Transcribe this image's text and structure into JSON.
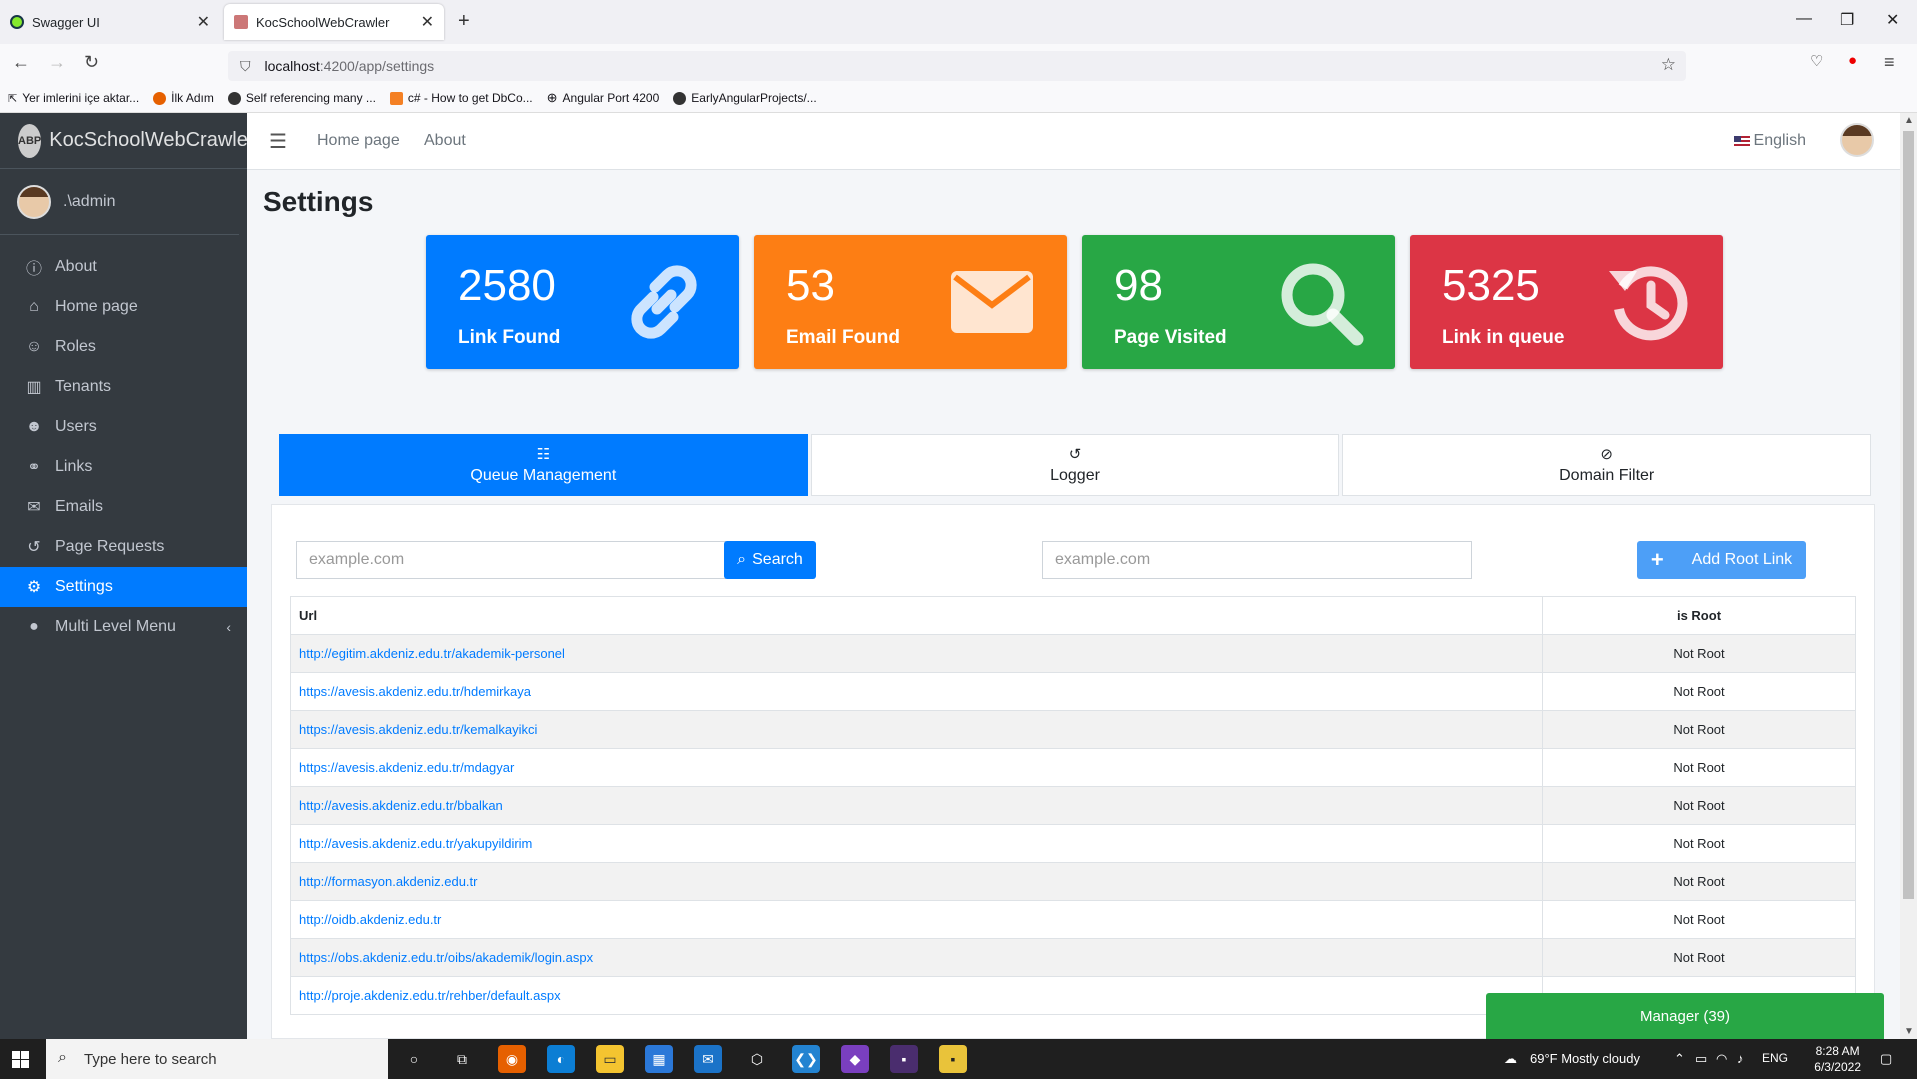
{
  "browser": {
    "tabs": [
      {
        "title": "Swagger UI",
        "active": false
      },
      {
        "title": "KocSchoolWebCrawler",
        "active": true
      }
    ],
    "url_host": "localhost",
    "url_path": ":4200/app/settings",
    "bookmarks": [
      "Yer imlerini içe aktar...",
      "İlk Adım",
      "Self referencing many ...",
      "c# - How to get DbCo...",
      "Angular Port 4200",
      "EarlyAngularProjects/..."
    ]
  },
  "sidebar": {
    "brand": "KocSchoolWebCrawler",
    "logo_text": "ABP",
    "user": ".\\admin",
    "items": [
      {
        "label": "About",
        "icon": "info-icon"
      },
      {
        "label": "Home page",
        "icon": "home-icon"
      },
      {
        "label": "Roles",
        "icon": "theater-masks-icon"
      },
      {
        "label": "Tenants",
        "icon": "building-icon"
      },
      {
        "label": "Users",
        "icon": "users-icon"
      },
      {
        "label": "Links",
        "icon": "link-icon"
      },
      {
        "label": "Emails",
        "icon": "envelope-icon"
      },
      {
        "label": "Page Requests",
        "icon": "history-icon"
      },
      {
        "label": "Settings",
        "icon": "gear-icon",
        "active": true
      },
      {
        "label": "Multi Level Menu",
        "icon": "circle-icon"
      }
    ]
  },
  "topnav": {
    "links": [
      "Home page",
      "About"
    ],
    "language": "English"
  },
  "page": {
    "title": "Settings",
    "stats": [
      {
        "value": "2580",
        "label": "Link Found",
        "color": "#007bff",
        "icon": "link-icon"
      },
      {
        "value": "53",
        "label": "Email Found",
        "color": "#fd7e14",
        "icon": "envelope-icon"
      },
      {
        "value": "98",
        "label": "Page Visited",
        "color": "#28a745",
        "icon": "search-icon"
      },
      {
        "value": "5325",
        "label": "Link in queue",
        "color": "#dc3545",
        "icon": "history-icon"
      }
    ],
    "tabs": [
      {
        "label": "Queue Management",
        "icon": "list-icon",
        "active": true
      },
      {
        "label": "Logger",
        "icon": "history-icon"
      },
      {
        "label": "Domain Filter",
        "icon": "ban-icon"
      }
    ],
    "search": {
      "placeholder": "example.com",
      "button": "Search"
    },
    "add_root": {
      "placeholder": "example.com",
      "button": "Add Root Link"
    },
    "table": {
      "headers": [
        "Url",
        "is Root"
      ],
      "rows": [
        [
          "http://egitim.akdeniz.edu.tr/akademik-personel",
          "Not Root"
        ],
        [
          "https://avesis.akdeniz.edu.tr/hdemirkaya",
          "Not Root"
        ],
        [
          "https://avesis.akdeniz.edu.tr/kemalkayikci",
          "Not Root"
        ],
        [
          "https://avesis.akdeniz.edu.tr/mdagyar",
          "Not Root"
        ],
        [
          "http://avesis.akdeniz.edu.tr/bbalkan",
          "Not Root"
        ],
        [
          "http://avesis.akdeniz.edu.tr/yakupyildirim",
          "Not Root"
        ],
        [
          "http://formasyon.akdeniz.edu.tr",
          "Not Root"
        ],
        [
          "http://oidb.akdeniz.edu.tr",
          "Not Root"
        ],
        [
          "https://obs.akdeniz.edu.tr/oibs/akademik/login.aspx",
          "Not Root"
        ],
        [
          "http://proje.akdeniz.edu.tr/rehber/default.aspx",
          ""
        ]
      ]
    },
    "manager_button": "Manager (39)"
  },
  "taskbar": {
    "search_placeholder": "Type here to search",
    "weather": "69°F  Mostly cloudy",
    "lang": "ENG",
    "time": "8:28 AM",
    "date": "6/3/2022"
  }
}
